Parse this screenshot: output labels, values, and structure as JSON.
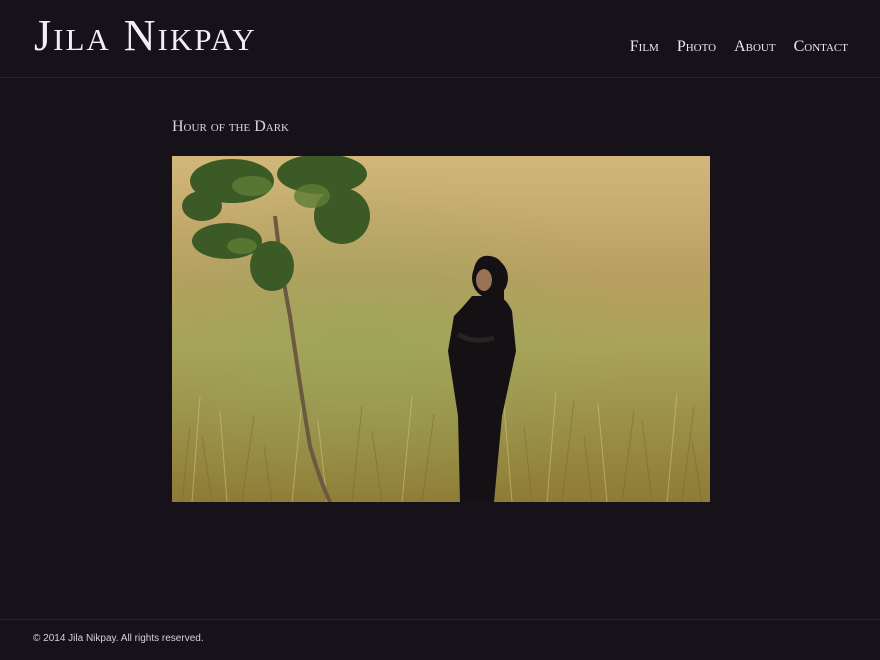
{
  "site": {
    "title": "Jila Nikpay"
  },
  "nav": {
    "items": [
      {
        "label": "Film"
      },
      {
        "label": "Photo"
      },
      {
        "label": "About"
      },
      {
        "label": "Contact"
      }
    ]
  },
  "main": {
    "title": "Hour of the Dark"
  },
  "footer": {
    "copyright": "© 2014 Jila Nikpay. All rights reserved."
  },
  "colors": {
    "background": "#17121a",
    "text": "#ddd6dc",
    "divider": "#2b2430"
  }
}
